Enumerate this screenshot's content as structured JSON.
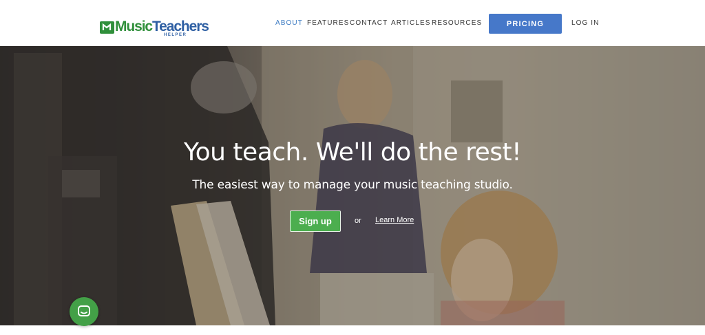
{
  "header": {
    "logo": {
      "word1": "Music",
      "word2": "Teachers",
      "sub": "HELPER",
      "brand_green": "#2f8f3a",
      "brand_blue": "#2e5fa3"
    },
    "nav": [
      {
        "label": "ABOUT",
        "active": true
      },
      {
        "label": "FEATURES",
        "active": false
      },
      {
        "label": "CONTACT",
        "active": false
      },
      {
        "label": "ARTICLES",
        "active": false
      },
      {
        "label": "RESOURCES",
        "active": false
      }
    ],
    "pricing_label": "PRICING",
    "login_label": "LOG IN",
    "active_color": "#3b7ac2",
    "pricing_color": "#4678c9"
  },
  "hero": {
    "title": "You teach. We'll do the rest!",
    "subtitle": "The easiest way to manage your music teaching studio.",
    "signup_label": "Sign up",
    "or_label": "or",
    "learn_more_label": "Learn More",
    "signup_color": "#4cae4f"
  },
  "chat": {
    "icon": "chat-bubble-icon",
    "color": "#43a047"
  }
}
